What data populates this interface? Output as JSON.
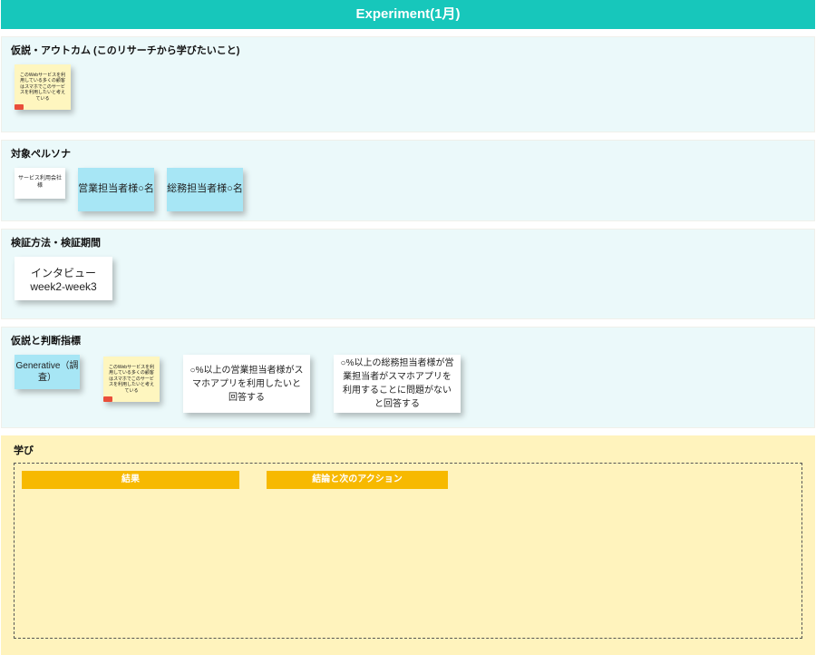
{
  "header": {
    "title": "Experiment(1月)"
  },
  "sections": {
    "hypothesis": {
      "label": "仮説・アウトカム (このリサーチから学びたいこと)",
      "notes": [
        "このWebサービスを利用している多くの顧客はスマホでこのサービスを利用したいと考えている"
      ]
    },
    "persona": {
      "label": "対象ペルソナ",
      "note_small": "サービス利用会社様",
      "note_a": "営業担当者様○名",
      "note_b": "総務担当者様○名"
    },
    "method": {
      "label": "検証方法・検証期間",
      "note": "インタビューweek2-week3"
    },
    "criteria": {
      "label": "仮説と判断指標",
      "gen": "Generative（調査）",
      "yellow": "このWebサービスを利用している多くの顧客はスマホでこのサービスを利用したいと考えている",
      "metric_a": "○%以上の営業担当者様がスマホアプリを利用したいと回答する",
      "metric_b": "○%以上の総務担当者様が営業担当者がスマホアプリを利用することに問題がないと回答する"
    }
  },
  "learning": {
    "label": "学び",
    "col_a": "結果",
    "col_b": "結論と次のアクション"
  }
}
